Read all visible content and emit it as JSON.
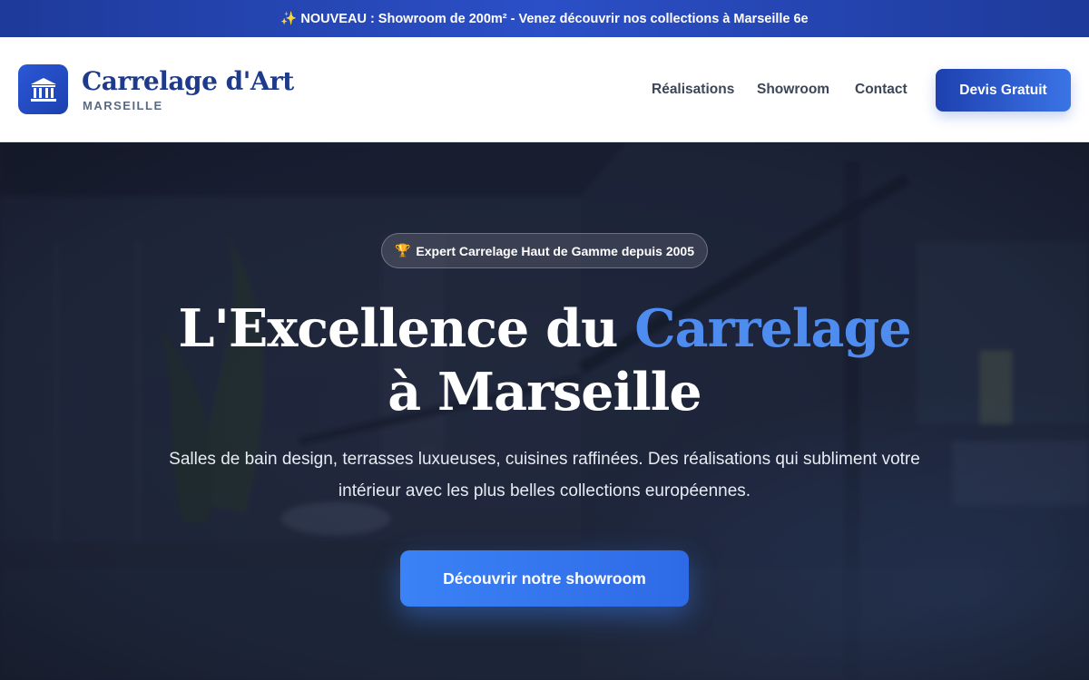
{
  "announcement": {
    "icon": "sparkles-icon",
    "icon_glyph": "✨",
    "text": "NOUVEAU : Showroom de 200m² - Venez découvrir nos collections à Marseille 6e"
  },
  "header": {
    "logo_icon": "classical-building-icon",
    "brand_name": "Carrelage d'Art",
    "brand_city": "MARSEILLE",
    "nav": [
      {
        "label": "Réalisations"
      },
      {
        "label": "Showroom"
      },
      {
        "label": "Contact"
      }
    ],
    "cta_label": "Devis Gratuit"
  },
  "hero": {
    "badge_icon": "trophy-icon",
    "badge_glyph": "🏆",
    "badge_text": "Expert Carrelage Haut de Gamme depuis 2005",
    "title_line1_a": "L'Excellence du ",
    "title_line1_accent": "Carrelage",
    "title_line2": "à Marseille",
    "subtitle_line1": "Salles de bain design, terrasses luxueuses, cuisines raffinées. Des réalisations qui subliment votre",
    "subtitle_line2": "intérieur avec les plus belles collections européennes.",
    "cta_label": "Découvrir notre showroom"
  },
  "colors": {
    "brand_dark": "#1e3a8a",
    "accent": "#4f8cf0",
    "button": "#3b82f6"
  }
}
